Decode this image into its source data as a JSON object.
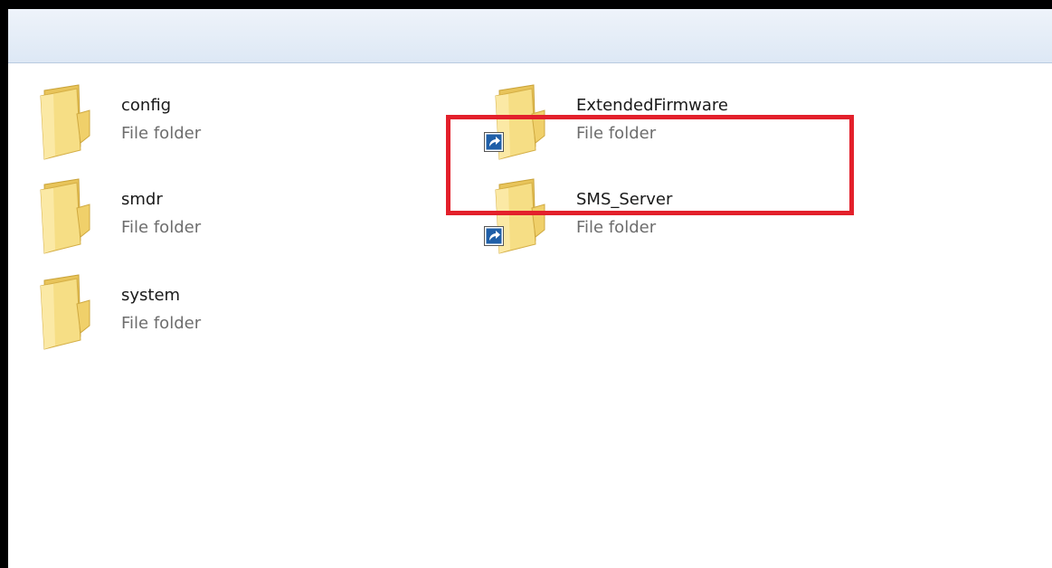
{
  "items": [
    {
      "name": "config",
      "type": "File folder",
      "shortcut": false
    },
    {
      "name": "smdr",
      "type": "File folder",
      "shortcut": false
    },
    {
      "name": "system",
      "type": "File folder",
      "shortcut": false
    },
    {
      "name": "ExtendedFirmware",
      "type": "File folder",
      "shortcut": true
    },
    {
      "name": "SMS_Server",
      "type": "File folder",
      "shortcut": true
    }
  ],
  "colors": {
    "highlight_border": "#e3202b",
    "folder_body": "#f2d36b",
    "shortcut_arrow": "#1f5fa8"
  }
}
